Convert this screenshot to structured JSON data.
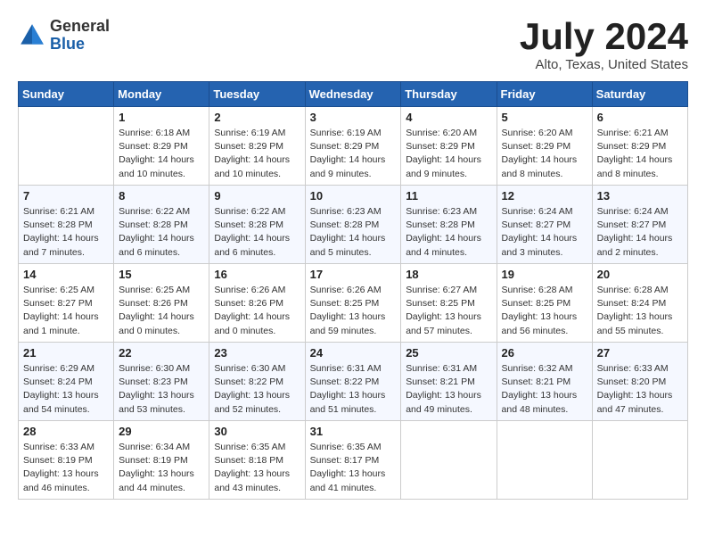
{
  "header": {
    "logo_general": "General",
    "logo_blue": "Blue",
    "month_title": "July 2024",
    "location": "Alto, Texas, United States"
  },
  "calendar": {
    "days_of_week": [
      "Sunday",
      "Monday",
      "Tuesday",
      "Wednesday",
      "Thursday",
      "Friday",
      "Saturday"
    ],
    "weeks": [
      [
        {
          "day": "",
          "info": ""
        },
        {
          "day": "1",
          "info": "Sunrise: 6:18 AM\nSunset: 8:29 PM\nDaylight: 14 hours\nand 10 minutes."
        },
        {
          "day": "2",
          "info": "Sunrise: 6:19 AM\nSunset: 8:29 PM\nDaylight: 14 hours\nand 10 minutes."
        },
        {
          "day": "3",
          "info": "Sunrise: 6:19 AM\nSunset: 8:29 PM\nDaylight: 14 hours\nand 9 minutes."
        },
        {
          "day": "4",
          "info": "Sunrise: 6:20 AM\nSunset: 8:29 PM\nDaylight: 14 hours\nand 9 minutes."
        },
        {
          "day": "5",
          "info": "Sunrise: 6:20 AM\nSunset: 8:29 PM\nDaylight: 14 hours\nand 8 minutes."
        },
        {
          "day": "6",
          "info": "Sunrise: 6:21 AM\nSunset: 8:29 PM\nDaylight: 14 hours\nand 8 minutes."
        }
      ],
      [
        {
          "day": "7",
          "info": "Sunrise: 6:21 AM\nSunset: 8:28 PM\nDaylight: 14 hours\nand 7 minutes."
        },
        {
          "day": "8",
          "info": "Sunrise: 6:22 AM\nSunset: 8:28 PM\nDaylight: 14 hours\nand 6 minutes."
        },
        {
          "day": "9",
          "info": "Sunrise: 6:22 AM\nSunset: 8:28 PM\nDaylight: 14 hours\nand 6 minutes."
        },
        {
          "day": "10",
          "info": "Sunrise: 6:23 AM\nSunset: 8:28 PM\nDaylight: 14 hours\nand 5 minutes."
        },
        {
          "day": "11",
          "info": "Sunrise: 6:23 AM\nSunset: 8:28 PM\nDaylight: 14 hours\nand 4 minutes."
        },
        {
          "day": "12",
          "info": "Sunrise: 6:24 AM\nSunset: 8:27 PM\nDaylight: 14 hours\nand 3 minutes."
        },
        {
          "day": "13",
          "info": "Sunrise: 6:24 AM\nSunset: 8:27 PM\nDaylight: 14 hours\nand 2 minutes."
        }
      ],
      [
        {
          "day": "14",
          "info": "Sunrise: 6:25 AM\nSunset: 8:27 PM\nDaylight: 14 hours\nand 1 minute."
        },
        {
          "day": "15",
          "info": "Sunrise: 6:25 AM\nSunset: 8:26 PM\nDaylight: 14 hours\nand 0 minutes."
        },
        {
          "day": "16",
          "info": "Sunrise: 6:26 AM\nSunset: 8:26 PM\nDaylight: 14 hours\nand 0 minutes."
        },
        {
          "day": "17",
          "info": "Sunrise: 6:26 AM\nSunset: 8:25 PM\nDaylight: 13 hours\nand 59 minutes."
        },
        {
          "day": "18",
          "info": "Sunrise: 6:27 AM\nSunset: 8:25 PM\nDaylight: 13 hours\nand 57 minutes."
        },
        {
          "day": "19",
          "info": "Sunrise: 6:28 AM\nSunset: 8:25 PM\nDaylight: 13 hours\nand 56 minutes."
        },
        {
          "day": "20",
          "info": "Sunrise: 6:28 AM\nSunset: 8:24 PM\nDaylight: 13 hours\nand 55 minutes."
        }
      ],
      [
        {
          "day": "21",
          "info": "Sunrise: 6:29 AM\nSunset: 8:24 PM\nDaylight: 13 hours\nand 54 minutes."
        },
        {
          "day": "22",
          "info": "Sunrise: 6:30 AM\nSunset: 8:23 PM\nDaylight: 13 hours\nand 53 minutes."
        },
        {
          "day": "23",
          "info": "Sunrise: 6:30 AM\nSunset: 8:22 PM\nDaylight: 13 hours\nand 52 minutes."
        },
        {
          "day": "24",
          "info": "Sunrise: 6:31 AM\nSunset: 8:22 PM\nDaylight: 13 hours\nand 51 minutes."
        },
        {
          "day": "25",
          "info": "Sunrise: 6:31 AM\nSunset: 8:21 PM\nDaylight: 13 hours\nand 49 minutes."
        },
        {
          "day": "26",
          "info": "Sunrise: 6:32 AM\nSunset: 8:21 PM\nDaylight: 13 hours\nand 48 minutes."
        },
        {
          "day": "27",
          "info": "Sunrise: 6:33 AM\nSunset: 8:20 PM\nDaylight: 13 hours\nand 47 minutes."
        }
      ],
      [
        {
          "day": "28",
          "info": "Sunrise: 6:33 AM\nSunset: 8:19 PM\nDaylight: 13 hours\nand 46 minutes."
        },
        {
          "day": "29",
          "info": "Sunrise: 6:34 AM\nSunset: 8:19 PM\nDaylight: 13 hours\nand 44 minutes."
        },
        {
          "day": "30",
          "info": "Sunrise: 6:35 AM\nSunset: 8:18 PM\nDaylight: 13 hours\nand 43 minutes."
        },
        {
          "day": "31",
          "info": "Sunrise: 6:35 AM\nSunset: 8:17 PM\nDaylight: 13 hours\nand 41 minutes."
        },
        {
          "day": "",
          "info": ""
        },
        {
          "day": "",
          "info": ""
        },
        {
          "day": "",
          "info": ""
        }
      ]
    ]
  }
}
